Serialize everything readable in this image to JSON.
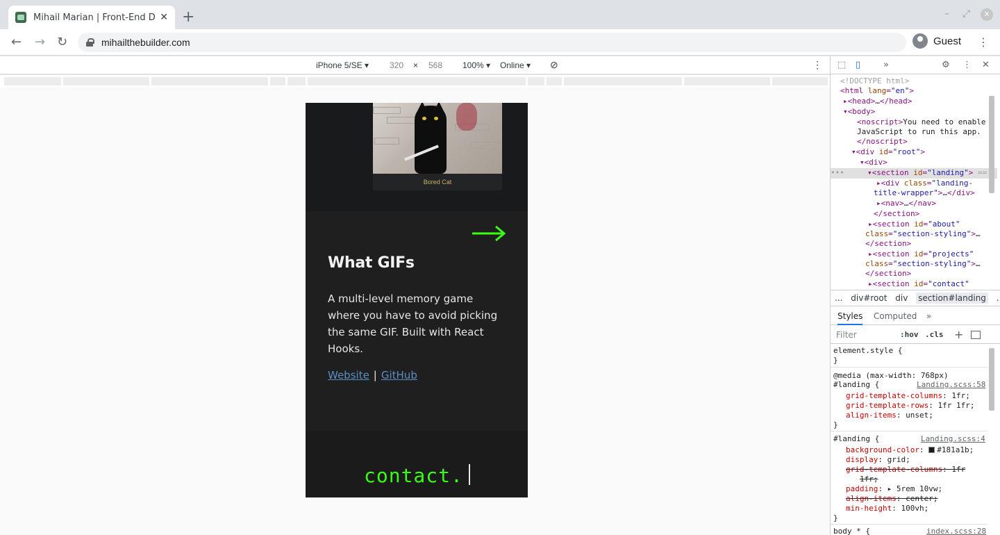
{
  "browser": {
    "tab_title": "Mihail Marian | Front-End Deve",
    "tab_close": "✕",
    "new_tab": "+",
    "url": "mihailthebuilder.com",
    "profile_label": "Guest"
  },
  "device_toolbar": {
    "device": "iPhone 5/SE ▾",
    "width": "320",
    "times": "×",
    "height": "568",
    "zoom": "100% ▾",
    "network": "Online ▾"
  },
  "page": {
    "image_caption": "Bored Cat",
    "project_title": "What GIFs",
    "project_description": "A multi-level memory game where you have to avoid picking the same GIF. Built with React Hooks.",
    "link_website": "Website",
    "link_separator": "|",
    "link_github": "GitHub",
    "contact_heading": "contact."
  },
  "devtools": {
    "more_tabs": "»",
    "breadcrumbs": [
      "...",
      "div#root",
      "div",
      "section#landing",
      "..."
    ],
    "styles_tab": "Styles",
    "computed_tab": "Computed",
    "more_panels": "»",
    "filter_placeholder": "Filter",
    "hov": ":hov",
    "cls": ".cls"
  },
  "colors": {
    "accent_green": "#39ff14",
    "link_blue": "#5b8fc4",
    "page_dark": "#181a1b"
  }
}
